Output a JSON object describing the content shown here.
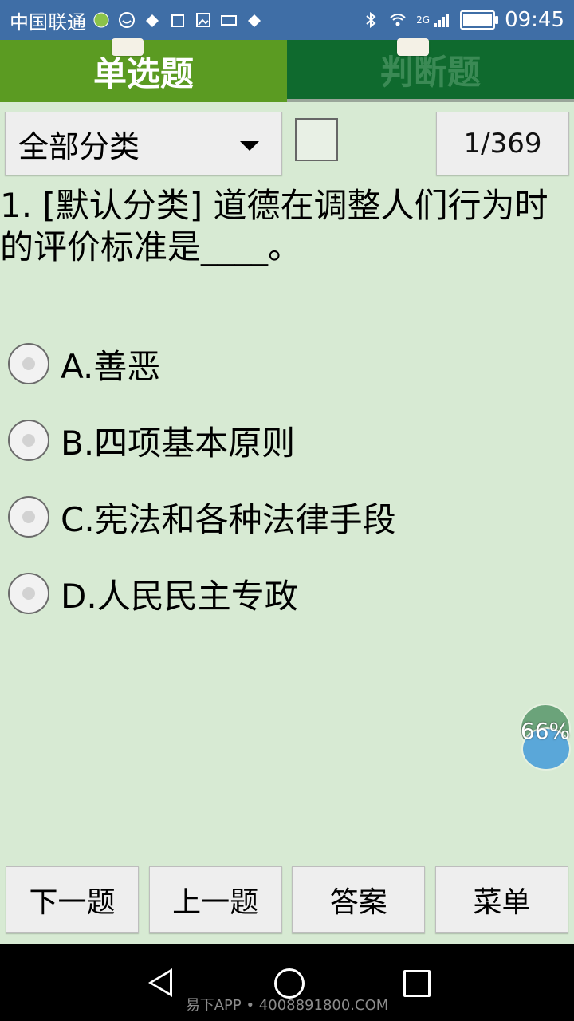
{
  "status_bar": {
    "carrier": "中国联通",
    "time": "09:45",
    "network": "2G"
  },
  "tabs": [
    {
      "label": "单选题",
      "active": true
    },
    {
      "label": "判断题",
      "active": false
    }
  ],
  "filter": {
    "selected": "全部分类"
  },
  "counter": "1/369",
  "question": {
    "text": "1. [默认分类] 道德在调整人们行为时的评价标准是____。"
  },
  "options": [
    {
      "label": "A.善恶"
    },
    {
      "label": "B.四项基本原则"
    },
    {
      "label": "C.宪法和各种法律手段"
    },
    {
      "label": "D.人民民主专政"
    }
  ],
  "floating_badge": {
    "percent": "66%"
  },
  "bottom_buttons": {
    "next": "下一题",
    "prev": "上一题",
    "answer": "答案",
    "menu": "菜单"
  },
  "watermark": "易下APP • 4008891800.COM",
  "colors": {
    "status_bg": "#3f6ea6",
    "tab_active": "#5b9b22",
    "tab_inactive": "#0f6a2e",
    "page_bg": "#d7ead3"
  }
}
